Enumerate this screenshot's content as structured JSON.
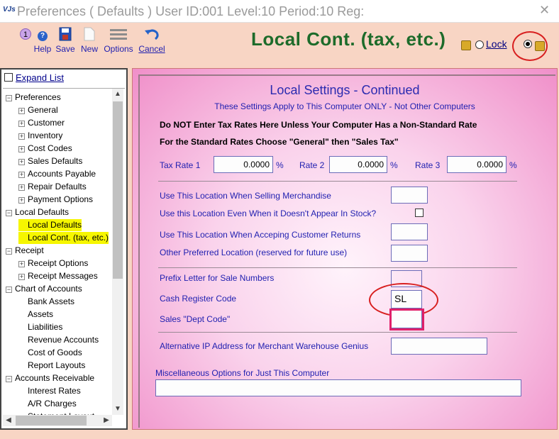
{
  "window": {
    "app_icon": "VJs",
    "title": "Preferences ( Defaults )    User ID:001 Level:10 Period:10 Reg:",
    "close_glyph": "✕"
  },
  "toolbar": {
    "help_badge": "1",
    "help_label": "Help",
    "save_label": "Save",
    "new_label": "New",
    "options_label": "Options",
    "cancel_label": "Cancel"
  },
  "header": {
    "page_title": "Local Cont. (tax, etc.)",
    "lock_label": "Lock"
  },
  "sidebar": {
    "expand_list_label": "Expand List",
    "items": [
      {
        "label": "Preferences",
        "level": 0,
        "toggle": "−"
      },
      {
        "label": "General",
        "level": 1,
        "toggle": "+"
      },
      {
        "label": "Customer",
        "level": 1,
        "toggle": "+"
      },
      {
        "label": "Inventory",
        "level": 1,
        "toggle": "+"
      },
      {
        "label": "Cost Codes",
        "level": 1,
        "toggle": "+"
      },
      {
        "label": "Sales Defaults",
        "level": 1,
        "toggle": "+"
      },
      {
        "label": "Accounts Payable",
        "level": 1,
        "toggle": "+"
      },
      {
        "label": "Repair Defaults",
        "level": 1,
        "toggle": "+"
      },
      {
        "label": "Payment Options",
        "level": 1,
        "toggle": "+"
      },
      {
        "label": "Local Defaults",
        "level": 0,
        "toggle": "−"
      },
      {
        "label": "Local Defaults",
        "level": 1,
        "toggle": "",
        "highlight": true
      },
      {
        "label": "Local Cont. (tax, etc.)",
        "level": 1,
        "toggle": "",
        "highlight": true
      },
      {
        "label": "Receipt",
        "level": 0,
        "toggle": "−"
      },
      {
        "label": "Receipt Options",
        "level": 1,
        "toggle": "+"
      },
      {
        "label": "Receipt Messages",
        "level": 1,
        "toggle": "+"
      },
      {
        "label": "Chart of Accounts",
        "level": 0,
        "toggle": "−"
      },
      {
        "label": "Bank Assets",
        "level": 1,
        "toggle": ""
      },
      {
        "label": "Assets",
        "level": 1,
        "toggle": ""
      },
      {
        "label": "Liabilities",
        "level": 1,
        "toggle": ""
      },
      {
        "label": "Revenue Accounts",
        "level": 1,
        "toggle": ""
      },
      {
        "label": "Cost of Goods",
        "level": 1,
        "toggle": ""
      },
      {
        "label": "Report Layouts",
        "level": 1,
        "toggle": ""
      },
      {
        "label": "Accounts Receivable",
        "level": 0,
        "toggle": "−"
      },
      {
        "label": "Interest Rates",
        "level": 1,
        "toggle": ""
      },
      {
        "label": "A/R Charges",
        "level": 1,
        "toggle": ""
      },
      {
        "label": "Statement Layout",
        "level": 1,
        "toggle": ""
      }
    ]
  },
  "form": {
    "title": "Local Settings - Continued",
    "subtitle": "These Settings Apply to This Computer ONLY - Not Other Computers",
    "warning_1": "Do NOT Enter Tax Rates Here Unless Your Computer Has a Non-Standard Rate",
    "warning_2": "For the Standard Rates Choose \"General\" then \"Sales Tax\"",
    "tax_rate_1_label": "Tax Rate 1",
    "tax_rate_1_value": "0.0000",
    "tax_rate_2_label": "Rate 2",
    "tax_rate_2_value": "0.0000",
    "tax_rate_3_label": "Rate 3",
    "tax_rate_3_value": "0.0000",
    "percent": "%",
    "sell_location_label": "Use This Location When Selling Merchandise",
    "sell_location_value": "",
    "even_when_label": "Use this Location Even When it Doesn't Appear In Stock?",
    "returns_location_label": "Use This Location When Acceping Customer Returns",
    "returns_location_value": "",
    "preferred_location_label": "Other Preferred Location (reserved for future use)",
    "preferred_location_value": "",
    "prefix_letter_label": "Prefix Letter for Sale Numbers",
    "prefix_letter_value": "",
    "cash_register_label": "Cash Register Code",
    "cash_register_value": "SL",
    "dept_code_label": "Sales \"Dept Code\"",
    "dept_code_value": "",
    "alt_ip_label": "Alternative IP Address for Merchant Warehouse Genius",
    "alt_ip_value": "",
    "misc_label": "Miscellaneous Options for Just This Computer",
    "misc_value": ""
  }
}
